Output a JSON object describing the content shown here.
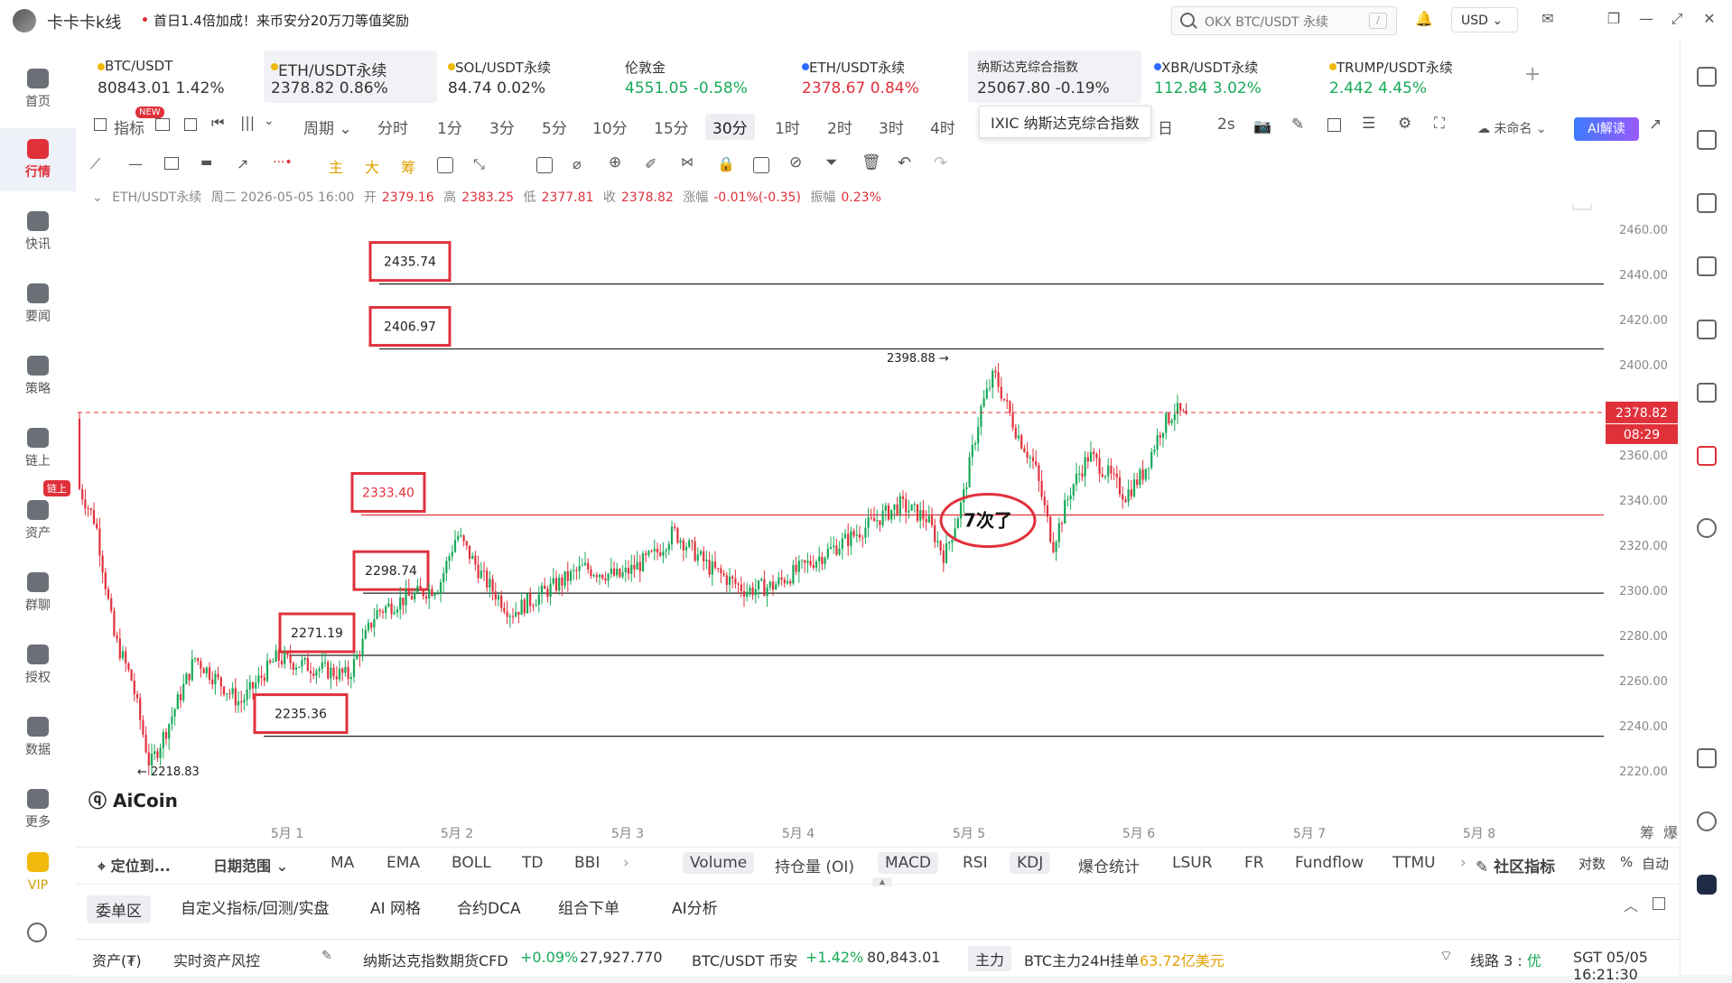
{
  "app": {
    "name": "卡卡卡k线",
    "promo": "首日1.4倍加成！来币安分20万刀等值奖励",
    "search_placeholder": "OKX BTC/USDT 永续",
    "search_shortcut": "/",
    "currency": "USD"
  },
  "left_rail": [
    {
      "label": "首页"
    },
    {
      "label": "行情"
    },
    {
      "label": "快讯"
    },
    {
      "label": "要闻"
    },
    {
      "label": "策略"
    },
    {
      "label": "链上"
    },
    {
      "label": "资产"
    },
    {
      "label": "群聊"
    },
    {
      "label": "授权"
    },
    {
      "label": "数据"
    },
    {
      "label": "更多"
    },
    {
      "label": "VIP"
    }
  ],
  "rail_badge": "链上",
  "tickers": [
    {
      "name": "BTC/USDT",
      "price": "80843.01",
      "change": "1.42%",
      "dir": "neutral",
      "dot": "#f0b90b"
    },
    {
      "name": "ETH/USDT永续",
      "price": "2378.82",
      "change": "0.86%",
      "dir": "neutral",
      "dot": "#f0b90b"
    },
    {
      "name": "SOL/USDT永续",
      "price": "84.74",
      "change": "0.02%",
      "dir": "neutral",
      "dot": "#f0b90b"
    },
    {
      "name": "伦敦金",
      "price": "4551.05",
      "change": "-0.58%",
      "dir": "up",
      "dot": ""
    },
    {
      "name": "ETH/USDT永续",
      "price": "2378.67",
      "change": "0.84%",
      "dir": "down",
      "dot": "#2f6bff"
    },
    {
      "name": "纳斯达克综合指数",
      "price": "25067.80",
      "change": "-0.19%",
      "dir": "neutral",
      "dot": ""
    },
    {
      "name": "XBR/USDT永续",
      "price": "112.84",
      "change": "3.02%",
      "dir": "up",
      "dot": "#2f6bff"
    },
    {
      "name": "TRUMP/USDT永续",
      "price": "2.442",
      "change": "4.45%",
      "dir": "up",
      "dot": "#f0b90b"
    }
  ],
  "tooltip": "IXIC 纳斯达克综合指数",
  "toolbar": {
    "indicator": "指标",
    "new": "NEW",
    "period": "周期",
    "timeframes": [
      "分时",
      "1分",
      "3分",
      "5分",
      "10分",
      "15分",
      "30分",
      "1时",
      "2时",
      "3时",
      "4时"
    ],
    "selected_tf": "30分",
    "day_suffix": "日",
    "refresh": "2s",
    "unnamed": "未命名",
    "ai": "AI解读"
  },
  "draw_colors": [
    "主",
    "大",
    "筹"
  ],
  "ohlc": {
    "symbol": "ETH/USDT永续",
    "date": "周二 2026-05-05 16:00",
    "open_label": "开",
    "open": "2379.16",
    "high_label": "高",
    "high": "2383.25",
    "low_label": "低",
    "low": "2377.81",
    "close_label": "收",
    "close": "2378.82",
    "chg_label": "涨幅",
    "chg": "-0.01%(-0.35)",
    "amp_label": "振幅",
    "amp": "0.23%"
  },
  "chart_data": {
    "type": "candlestick",
    "ylim": [
      2210,
      2470
    ],
    "y_ticks": [
      "2460.00",
      "2440.00",
      "2420.00",
      "2400.00",
      "2380.00",
      "2360.00",
      "2340.00",
      "2320.00",
      "2300.00",
      "2280.00",
      "2260.00",
      "2240.00",
      "2220.00"
    ],
    "x_ticks": [
      "5月 1",
      "5月 2",
      "5月 3",
      "5月 4",
      "5月 5",
      "5月 6",
      "5月 7",
      "5月 8"
    ],
    "current_price": "2378.82",
    "countdown": "08:29",
    "high_label": "2398.88",
    "low_label": "2218.83",
    "levels": [
      {
        "value": 2435.74,
        "label": "2435.74",
        "color": "#222"
      },
      {
        "value": 2406.97,
        "label": "2406.97",
        "color": "#222"
      },
      {
        "value": 2333.4,
        "label": "2333.40",
        "color": "#e0313b"
      },
      {
        "value": 2298.74,
        "label": "2298.74",
        "color": "#222"
      },
      {
        "value": 2271.19,
        "label": "2271.19",
        "color": "#222"
      },
      {
        "value": 2235.36,
        "label": "2235.36",
        "color": "#222"
      }
    ],
    "annotation": "7次了",
    "watermark": "AiCoin",
    "side_labels": [
      "筹",
      "爆"
    ]
  },
  "bottom_tools": {
    "locate": "定位到...",
    "range": "日期范围",
    "main": [
      "MA",
      "EMA",
      "BOLL",
      "TD",
      "BBI"
    ],
    "sub": [
      "Volume",
      "持仓量 (OI)",
      "MACD",
      "RSI",
      "KDJ",
      "爆仓统计",
      "LSUR",
      "FR",
      "Fundflow",
      "TTMU"
    ],
    "community": "社区指标",
    "log": "对数",
    "pct": "%",
    "auto": "自动"
  },
  "sections": [
    "委单区",
    "自定义指标/回测/实盘",
    "AI 网格",
    "合约DCA",
    "组合下单",
    "AI分析"
  ],
  "status": {
    "assets": "资产(₮)",
    "risk": "实时资产风控",
    "nasdaq": "纳斯达克指数期货CFD",
    "nasdaq_chg": "+0.09%",
    "nasdaq_px": "27,927.770",
    "btc": "BTC/USDT 币安",
    "btc_chg": "+1.42%",
    "btc_px": "80,843.01",
    "main_force": "主力",
    "btc_order": "BTC主力24H挂单",
    "btc_order_val": "63.72亿美元",
    "line": "线路 3 :",
    "line_q": "优",
    "time": "SGT 05/05 16:21:30"
  }
}
